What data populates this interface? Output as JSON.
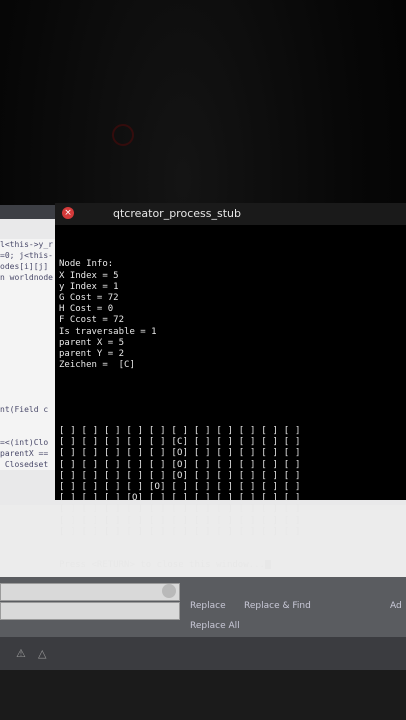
{
  "terminal": {
    "title": "qtcreator_process_stub",
    "info_lines": [
      "Node Info:",
      "X Index = 5",
      "y Index = 1",
      "G Cost = 72",
      "H Cost = 0",
      "F Ccost = 72",
      "Is traversable = 1",
      "parent X = 5",
      "parent Y = 2",
      "Zeichen =  [C]"
    ],
    "grid_rows": [
      "[ ] [ ] [ ] [ ] [ ] [ ] [ ] [ ] [ ] [ ] [ ]",
      "[ ] [ ] [ ] [ ] [ ] [C] [ ] [ ] [ ] [ ] [ ]",
      "[ ] [ ] [ ] [ ] [ ] [O] [ ] [ ] [ ] [ ] [ ]",
      "[ ] [ ] [ ] [ ] [ ] [O] [ ] [ ] [ ] [ ] [ ]",
      "[ ] [ ] [ ] [ ] [ ] [O] [ ] [ ] [ ] [ ] [ ]",
      "[ ] [ ] [ ] [ ] [O] [ ] [ ] [ ] [ ] [ ] [ ]",
      "[ ] [ ] [ ] [O] [ ] [ ] [ ] [ ] [ ] [ ] [ ]",
      "[ ] [ ] [ ] [ ] [ ] [ ] [ ] [ ] [ ] [ ] [ ]",
      "[ ] [ ] [ ] [ ] [ ] [ ] [ ] [ ] [ ] [ ] [ ]",
      "[ ] [ ] [ ] [ ] [ ] [ ] [ ] [ ] [ ] [ ] [ ]"
    ],
    "prompt": "Press <RETURN> to close this window..."
  },
  "ide": {
    "code_lines": [
      "l<this->y_r",
      "=0; j<this-",
      "odes[i][j]",
      "n worldnode",
      "",
      "",
      "",
      "",
      "",
      "",
      "",
      "",
      "",
      "",
      "",
      "nt(Field c",
      "",
      "",
      "=<(int)Clo",
      "parentX ==",
      " Closedset"
    ],
    "find": {
      "replace_label": "Replace",
      "replace_find_label": "Replace & Find",
      "replace_all_label": "Replace All",
      "extra_label": "Ad"
    }
  }
}
